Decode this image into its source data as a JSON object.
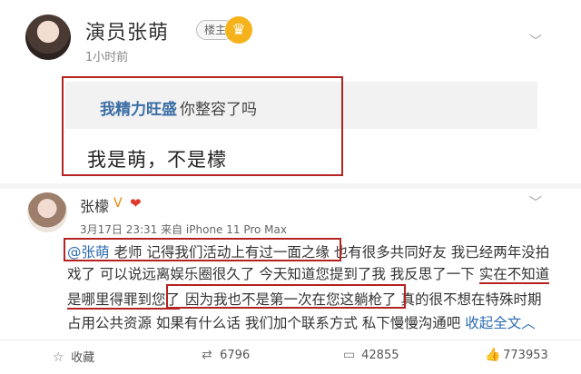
{
  "post1": {
    "user_name": "演员张萌",
    "owner_badge": "楼主",
    "vip_icon": "crown-icon",
    "time": "1小时前",
    "menu_icon": "chevron-down-icon",
    "quote": {
      "user": "我精力旺盛",
      "sep": ":",
      "text": "你整容了吗"
    },
    "reply": "我是萌，不是檬"
  },
  "post2": {
    "user_name": "张檬",
    "vip_badge": "V",
    "heart": "❤",
    "meta": "3月17日 23:31 来自 iPhone 11 Pro Max",
    "menu_icon": "chevron-down-icon",
    "body": {
      "mention": "@张萌",
      "p1": " 老师  记得我们活动上有过一面之缘",
      "p2": " 也有很多共同好友  我已经两年没拍",
      "p3": "戏了  可以说远离娱乐圈很久了  今天知道您提到了我  我反思了一下  ",
      "p4": "实在不知道",
      "p5": "是哪里得罪到您了",
      "p6": "因为我也不是第一次在您这躺枪了",
      "p7": "  真的很不想在特殊时期",
      "p8": "占用公共资源  如果有什么话  我们加个联系方式  私下慢慢沟通吧  ",
      "collapse": "收起全文",
      "collapse_icon": "chevron-up-icon"
    }
  },
  "actions": {
    "favorite": {
      "icon": "star-icon",
      "label": "收藏"
    },
    "repost": {
      "icon": "repost-icon",
      "count": "6796"
    },
    "comment": {
      "icon": "comment-icon",
      "count": "42855"
    },
    "like": {
      "icon": "thumbs-up-icon",
      "count": "773953"
    }
  },
  "colors": {
    "highlight_box": "#b42222",
    "link": "#2c6bb0",
    "vip": "#f5b21a"
  }
}
